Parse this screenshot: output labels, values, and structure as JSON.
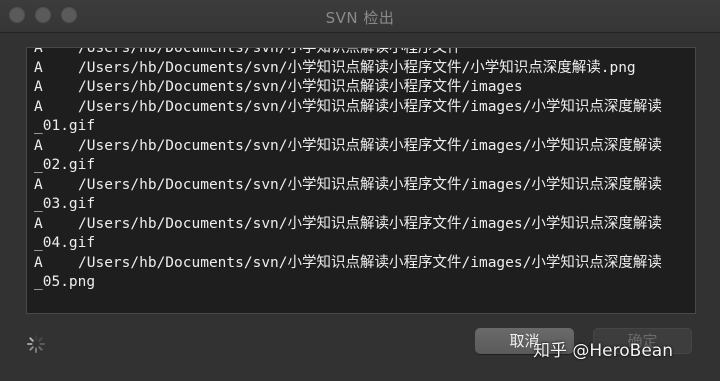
{
  "window": {
    "title": "SVN 检出"
  },
  "log": {
    "lines": [
      {
        "action": "A",
        "path": "/Users/hb/Documents/svn/小学知识点解读小程序文件",
        "cont": ""
      },
      {
        "action": "A",
        "path": "/Users/hb/Documents/svn/小学知识点解读小程序文件/小学知识点深度解读.png",
        "cont": ""
      },
      {
        "action": "A",
        "path": "/Users/hb/Documents/svn/小学知识点解读小程序文件/images",
        "cont": ""
      },
      {
        "action": "A",
        "path": "/Users/hb/Documents/svn/小学知识点解读小程序文件/images/小学知识点深度解读",
        "cont": "_01.gif"
      },
      {
        "action": "A",
        "path": "/Users/hb/Documents/svn/小学知识点解读小程序文件/images/小学知识点深度解读",
        "cont": "_02.gif"
      },
      {
        "action": "A",
        "path": "/Users/hb/Documents/svn/小学知识点解读小程序文件/images/小学知识点深度解读",
        "cont": "_03.gif"
      },
      {
        "action": "A",
        "path": "/Users/hb/Documents/svn/小学知识点解读小程序文件/images/小学知识点深度解读",
        "cont": "_04.gif"
      },
      {
        "action": "A",
        "path": "/Users/hb/Documents/svn/小学知识点解读小程序文件/images/小学知识点深度解读",
        "cont": "_05.png"
      }
    ]
  },
  "buttons": {
    "cancel": "取消",
    "ok": "确定"
  },
  "watermark": {
    "text": "知乎 @HeroBean"
  },
  "icons": {
    "spinner": "activity-spinner-icon"
  },
  "colors": {
    "cancel_bg": "#616161",
    "log_bg": "#1e1e1e",
    "window_bg": "#323232"
  }
}
